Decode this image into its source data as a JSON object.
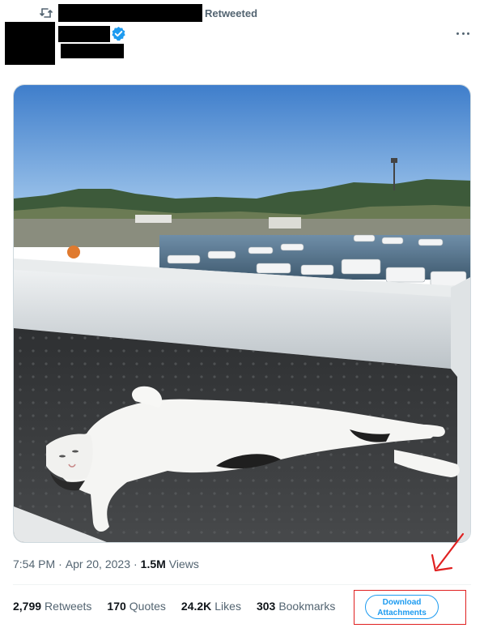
{
  "retweet": {
    "label": "Retweeted",
    "icon": "retweet-icon"
  },
  "author": {
    "verified_icon": "verified-badge-icon",
    "verified_color": "#1d9bf0"
  },
  "more_menu_icon": "more-options-icon",
  "media": {
    "icon": "photo-cat-sunbathing"
  },
  "tweet_meta": {
    "time": "7:54 PM",
    "date": "Apr 20, 2023",
    "views_count": "1.5M",
    "views_label": "Views"
  },
  "stats": [
    {
      "count": "2,799",
      "label": "Retweets"
    },
    {
      "count": "170",
      "label": "Quotes"
    },
    {
      "count": "24.2K",
      "label": "Likes"
    },
    {
      "count": "303",
      "label": "Bookmarks"
    }
  ],
  "download": {
    "line1": "Download",
    "line2": "Attachments",
    "accent": "#1d9bf0",
    "highlight_color": "#e02020"
  },
  "annotation_arrow_icon": "red-arrow-annotation-icon"
}
